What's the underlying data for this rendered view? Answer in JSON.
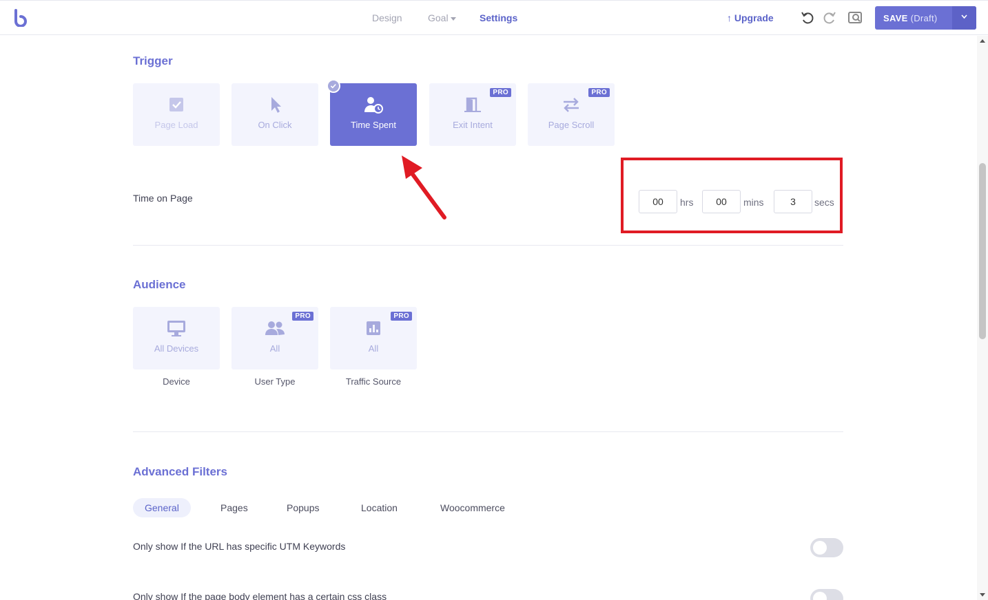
{
  "header": {
    "nav": [
      "Design",
      "Goal",
      "Settings"
    ],
    "active_nav": "Settings",
    "upgrade_label": "Upgrade",
    "save_label": "SAVE",
    "save_status": "(Draft)"
  },
  "trigger": {
    "title": "Trigger",
    "options": [
      {
        "label": "Page Load",
        "icon": "checkbox-icon",
        "state": "disabled"
      },
      {
        "label": "On Click",
        "icon": "cursor-icon",
        "state": "normal"
      },
      {
        "label": "Time Spent",
        "icon": "user-clock-icon",
        "state": "selected"
      },
      {
        "label": "Exit Intent",
        "icon": "door-icon",
        "pro": "PRO"
      },
      {
        "label": "Page Scroll",
        "icon": "arrows-exchange-icon",
        "pro": "PRO"
      }
    ],
    "time_on_page": {
      "label": "Time on Page",
      "hrs": "00",
      "hrs_unit": "hrs",
      "mins": "00",
      "mins_unit": "mins",
      "secs": "3",
      "secs_unit": "secs"
    }
  },
  "audience": {
    "title": "Audience",
    "options": [
      {
        "label": "All Devices",
        "caption": "Device",
        "icon": "monitor-icon"
      },
      {
        "label": "All",
        "caption": "User Type",
        "icon": "users-icon",
        "pro": "PRO"
      },
      {
        "label": "All",
        "caption": "Traffic Source",
        "icon": "bar-chart-icon",
        "pro": "PRO"
      }
    ]
  },
  "advanced": {
    "title": "Advanced Filters",
    "tabs": [
      "General",
      "Pages",
      "Popups",
      "Location",
      "Woocommerce"
    ],
    "active_tab": "General",
    "filters": [
      {
        "label": "Only show If the URL has specific UTM Keywords",
        "enabled": false
      },
      {
        "label": "Only show If the page body element has a certain css class",
        "enabled": false
      }
    ]
  },
  "colors": {
    "accent": "#6b70d4",
    "highlight": "#e01b24"
  }
}
